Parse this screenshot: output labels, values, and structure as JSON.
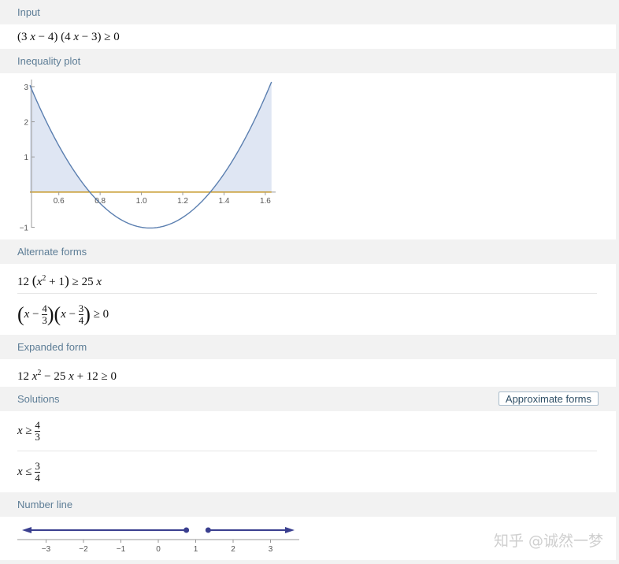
{
  "pods": {
    "input": {
      "title": "Input",
      "expr_a": "(3 ",
      "expr_b": "x",
      "expr_c": " − 4) (4 ",
      "expr_d": "x",
      "expr_e": " − 3) ≥ 0"
    },
    "plot": {
      "title": "Inequality plot"
    },
    "alternate": {
      "title": "Alternate forms"
    },
    "expanded": {
      "title": "Expanded form"
    },
    "solutions": {
      "title": "Solutions",
      "button": "Approximate forms"
    },
    "numberline": {
      "title": "Number line"
    }
  },
  "alt1": {
    "a": "12 ",
    "b": "x",
    "c": "2",
    "d": " + 1",
    "e": " ≥ 25 ",
    "f": "x"
  },
  "alt2": {
    "x1": "x",
    "m1": " − ",
    "n1": "4",
    "d1": "3",
    "x2": "x",
    "m2": " − ",
    "n2": "3",
    "d2": "4",
    "rel": " ≥ 0"
  },
  "expanded_expr": {
    "a": "12 ",
    "b": "x",
    "c": "2",
    "d": " − 25 ",
    "e": "x",
    "f": " + 12 ≥ 0"
  },
  "sol1": {
    "v": "x",
    "rel": " ≥ ",
    "num": "4",
    "den": "3"
  },
  "sol2": {
    "v": "x",
    "rel": " ≤ ",
    "num": "3",
    "den": "4"
  },
  "watermark": "知乎 @诚然一梦",
  "chart_data": [
    {
      "type": "area",
      "function": "(3x-4)(4x-3)",
      "x_range": [
        0.46,
        1.63
      ],
      "xlim": [
        0.46,
        1.65
      ],
      "ylim": [
        -1.1,
        3.2
      ],
      "x_ticks": [
        "0.6",
        "0.8",
        "1.0",
        "1.2",
        "1.4",
        "1.6"
      ],
      "y_ticks": [
        "3",
        "2",
        "1",
        "−1"
      ],
      "shaded_region": "f(x) ≥ 0",
      "curve_color": "#5b7fb0",
      "shade_color": "#dfe6f3",
      "axis_color": "#c89a2a"
    },
    {
      "type": "number-line",
      "xlim": [
        -3.6,
        3.6
      ],
      "ticks": [
        "−3",
        "−2",
        "−1",
        "0",
        "1",
        "2",
        "3"
      ],
      "closed_points": [
        0.75,
        1.3333
      ],
      "rays": [
        "left",
        "right"
      ],
      "color": "#3a3f8f"
    }
  ]
}
